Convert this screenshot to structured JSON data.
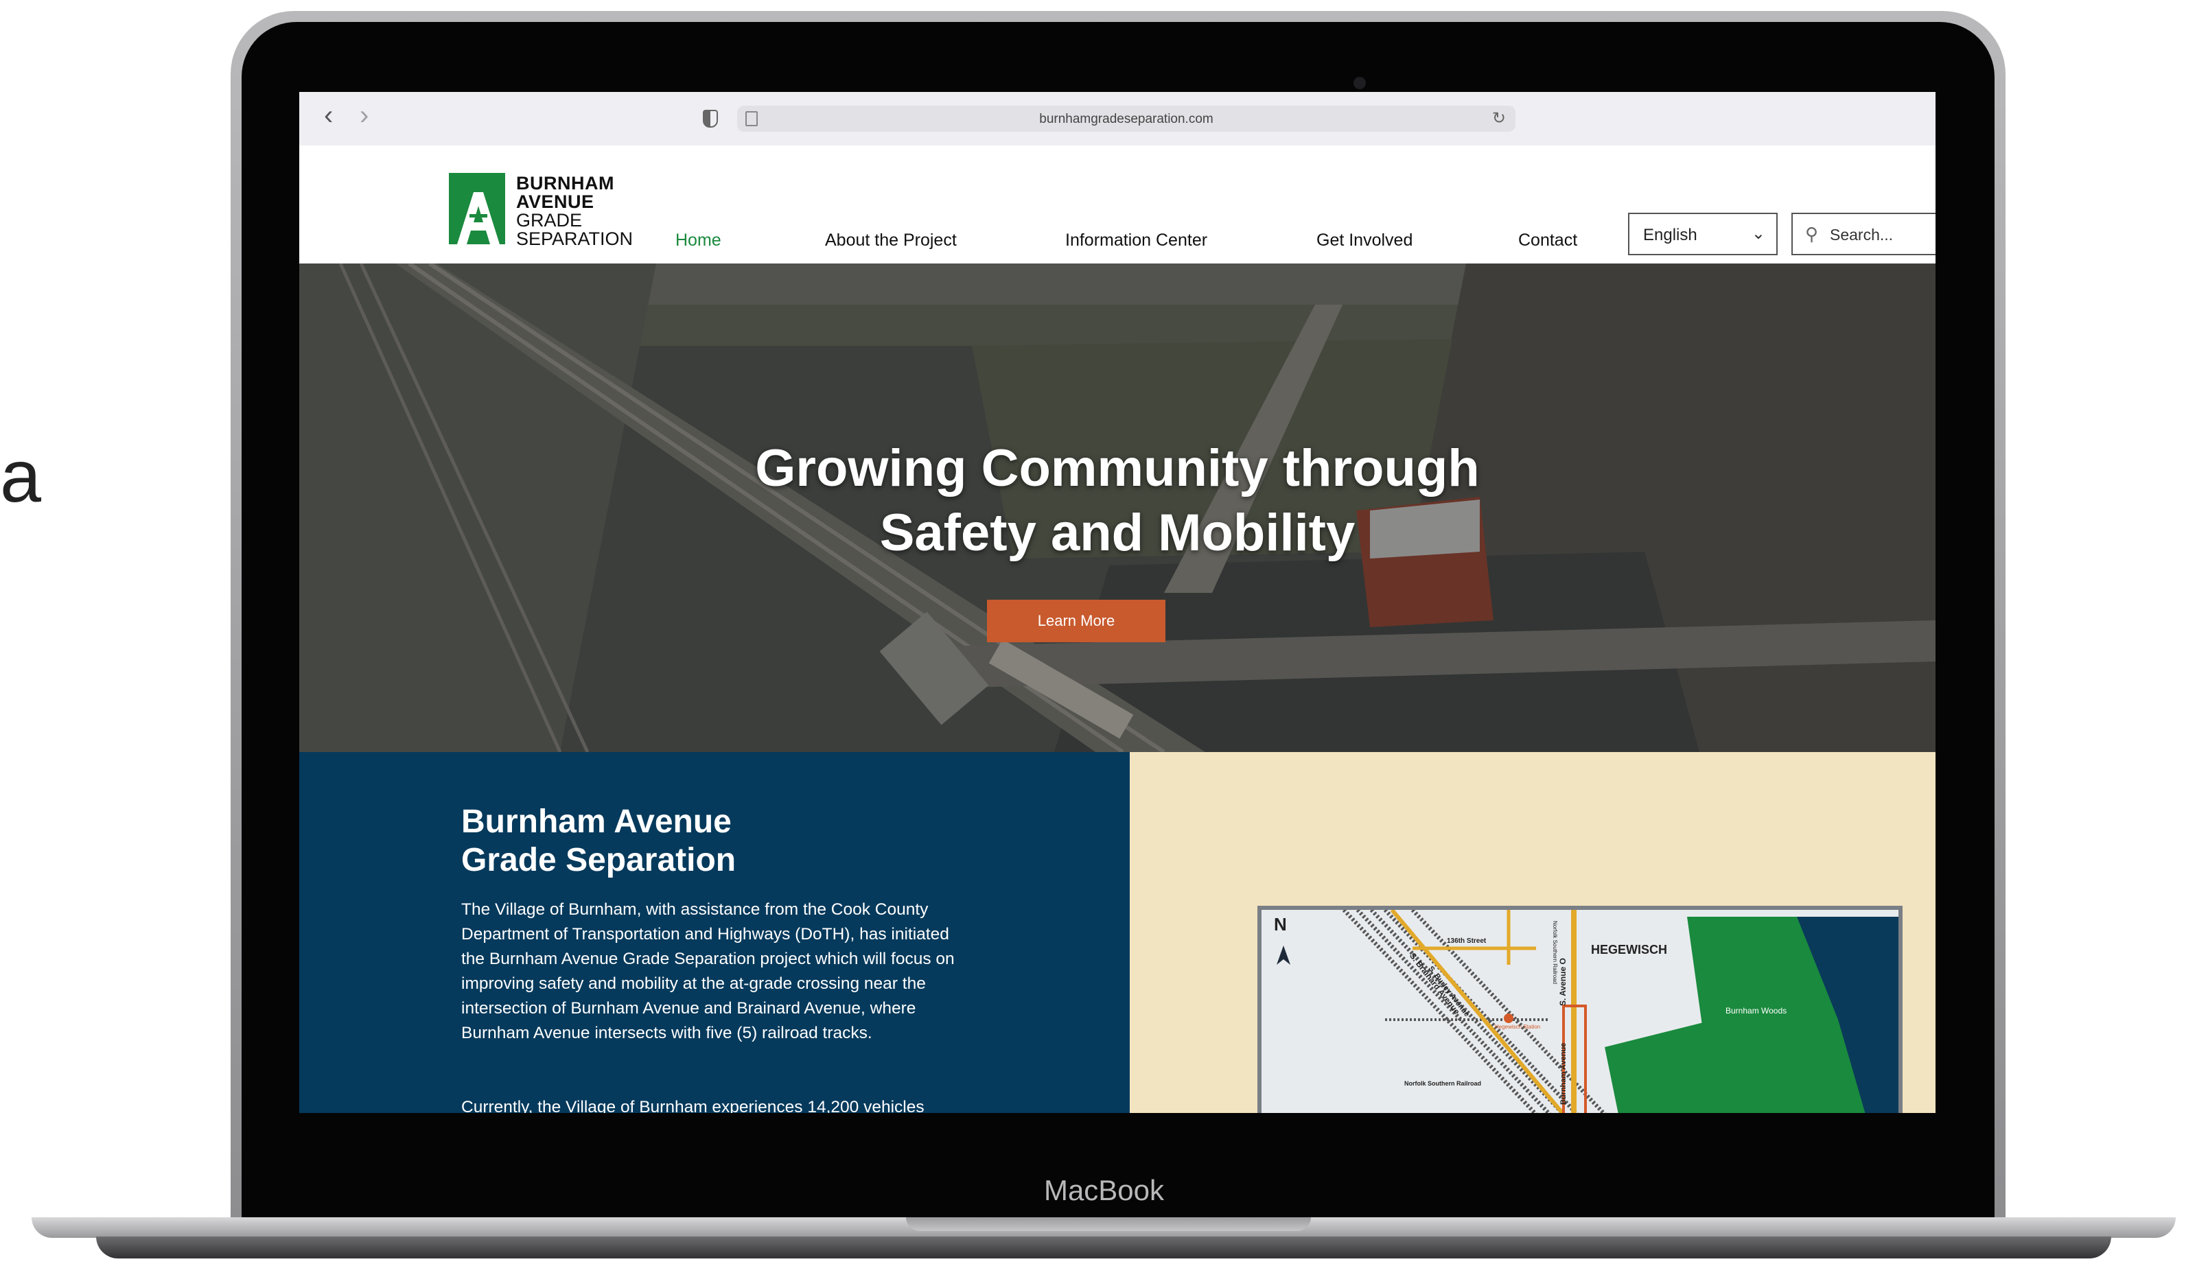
{
  "figure_label": "a",
  "laptop_brand": "MacBook",
  "browser": {
    "url": "burnhamgradeseparation.com",
    "back": "‹",
    "forward": "›",
    "reload": "↻"
  },
  "logo": {
    "line1": "BURNHAM",
    "line2": "AVENUE",
    "line3": "GRADE",
    "line4": "SEPARATION"
  },
  "nav": {
    "home": "Home",
    "about": "About the Project",
    "info": "Information Center",
    "involved": "Get Involved",
    "contact": "Contact"
  },
  "language": {
    "selected": "English"
  },
  "search": {
    "placeholder": "Search..."
  },
  "hero": {
    "title_line1": "Growing Community through",
    "title_line2": "Safety and Mobility",
    "button": "Learn More"
  },
  "info": {
    "title_line1": "Burnham Avenue",
    "title_line2": "Grade Separation",
    "body": "The Village of Burnham, with assistance from the Cook County Department of Transportation and Highways (DoTH), has initiated the Burnham Avenue Grade Separation project which will focus on improving safety and mobility at the at-grade crossing near the intersection of Burnham Avenue and Brainard Avenue, where Burnham Avenue intersects with five (5) railroad tracks.",
    "body_more": "Currently, the Village of Burnham experiences 14,200 vehicles"
  },
  "map": {
    "north": "N",
    "hegewisch": "HEGEWISCH",
    "burnham_woods": "Burnham Woods",
    "street_136": "136th Street",
    "burley": "S. Burley Avenue",
    "brainard": "S. Brainard Avenue",
    "avenue_o": "S. Avenue O",
    "burnham_ave": "Burnham Avenue",
    "norfolk": "Norfolk Southern Railroad",
    "norfolk_rail": "Norfolk Southern Railroad",
    "station": "Hegewisch Station",
    "colors": {
      "water": "#0a3a5a",
      "park": "#1a8a3e",
      "road": "#e2a92a",
      "project": "#d45a2a"
    }
  },
  "colors": {
    "brand_green": "#1a8a3e",
    "panel_blue": "#063a5c",
    "map_bg": "#f2e4c0",
    "cta": "#c85a2e"
  }
}
